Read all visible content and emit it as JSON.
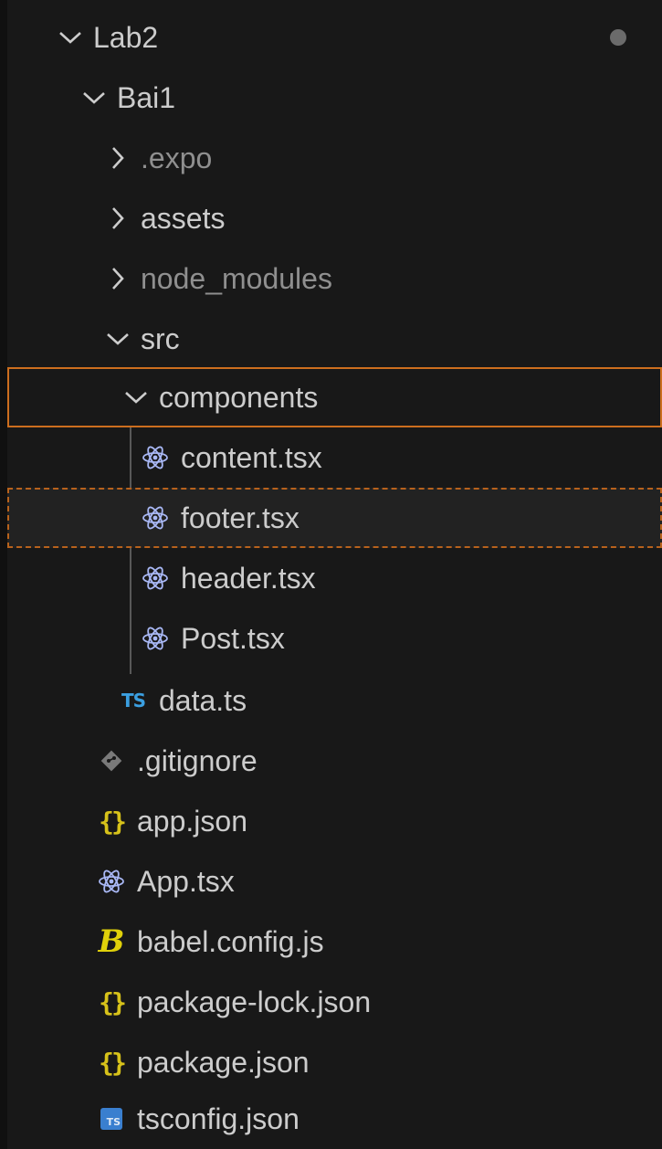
{
  "explorer": {
    "root": {
      "label": "Lab2"
    },
    "bai1": {
      "label": "Bai1"
    },
    "expo": {
      "label": ".expo"
    },
    "assets": {
      "label": "assets"
    },
    "node_modules": {
      "label": "node_modules"
    },
    "src": {
      "label": "src"
    },
    "components": {
      "label": "components"
    },
    "content": {
      "label": "content.tsx",
      "icon": "react-icon"
    },
    "footer": {
      "label": "footer.tsx",
      "icon": "react-icon"
    },
    "header": {
      "label": "header.tsx",
      "icon": "react-icon"
    },
    "post": {
      "label": "Post.tsx",
      "icon": "react-icon"
    },
    "data_ts": {
      "label": "data.ts",
      "icon_text": "TS"
    },
    "gitignore": {
      "label": ".gitignore",
      "icon": "git-icon"
    },
    "app_json": {
      "label": "app.json",
      "icon_text": "{}"
    },
    "app_tsx": {
      "label": "App.tsx",
      "icon": "react-icon"
    },
    "babel": {
      "label": "babel.config.js",
      "icon_text": "B"
    },
    "package_lock": {
      "label": "package-lock.json",
      "icon_text": "{}"
    },
    "package_json": {
      "label": "package.json",
      "icon_text": "{}"
    },
    "tsconfig": {
      "label": "tsconfig.json",
      "icon_text": "TS"
    }
  },
  "colors": {
    "background": "#181818",
    "text": "#cccccc",
    "dim_text": "#8f8f8f",
    "selection_border": "#cc6e1e",
    "react": "#a9b8f5",
    "ts": "#3b9fe0",
    "json": "#d7c21a"
  }
}
